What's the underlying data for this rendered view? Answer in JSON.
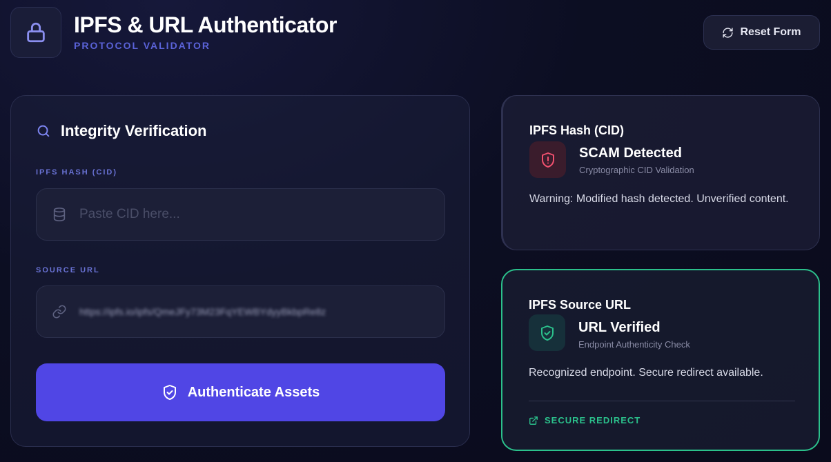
{
  "header": {
    "title": "IPFS & URL Authenticator",
    "subtitle": "PROTOCOL VALIDATOR",
    "reset_label": "Reset Form"
  },
  "form": {
    "title": "Integrity Verification",
    "cid": {
      "label": "IPFS HASH (CID)",
      "value": "",
      "placeholder": "Paste CID here..."
    },
    "url": {
      "label": "SOURCE URL",
      "value": "https://ipfs.io/ipfs/QmeJFy73M23FqYEWBYdyyBkbpRe8z"
    },
    "submit_label": "Authenticate Assets"
  },
  "results": {
    "cid": {
      "title": "IPFS Hash (CID)",
      "status": "SCAM Detected",
      "check": "Cryptographic CID Validation",
      "message": "Warning: Modified hash detected. Unverified content."
    },
    "url": {
      "title": "IPFS Source URL",
      "status": "URL Verified",
      "check": "Endpoint Authenticity Check",
      "message": "Recognized endpoint. Secure redirect available.",
      "link_label": "SECURE REDIRECT"
    }
  },
  "colors": {
    "accent": "#5046e5",
    "label": "#6a73d6",
    "danger": "#f0506e",
    "success": "#2bc08b"
  }
}
